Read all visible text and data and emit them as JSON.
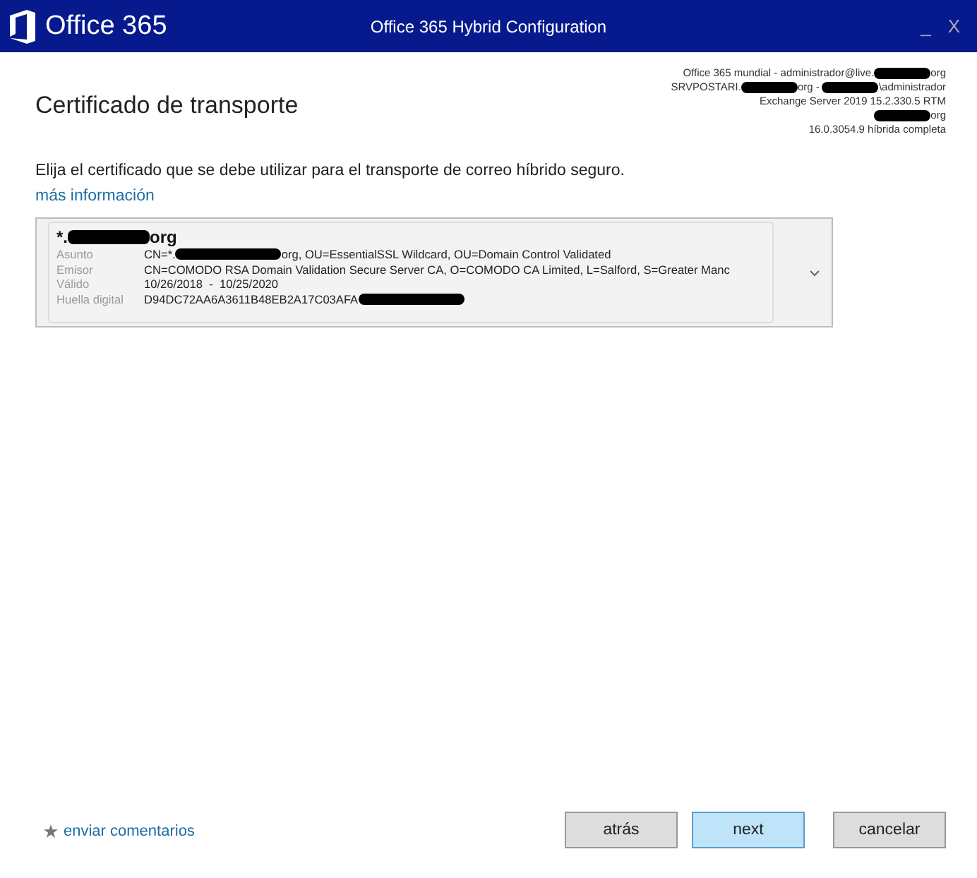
{
  "window": {
    "logo": "Office 365",
    "title": "Office 365 Hybrid Configuration",
    "controls": [
      "_",
      "X"
    ]
  },
  "connection_info": [
    [
      {
        "kind": "text",
        "text": "Office 365 mundial - administrador@live."
      },
      {
        "kind": "redacted"
      },
      {
        "kind": "text",
        "text": "org"
      }
    ],
    [
      {
        "kind": "text",
        "text": "SRVPOSTARI."
      },
      {
        "kind": "redacted"
      },
      {
        "kind": "text",
        "text": "org - "
      },
      {
        "kind": "redacted"
      },
      {
        "kind": "text",
        "text": "\\administrador"
      }
    ],
    [
      {
        "kind": "text",
        "text": "Exchange Server 2019 15.2.330.5 RTM"
      }
    ],
    [
      {
        "kind": "redacted"
      },
      {
        "kind": "text",
        "text": "org"
      }
    ],
    [
      {
        "kind": "text",
        "text": "16.0.3054.9 híbrida completa"
      }
    ]
  ],
  "heading": "Certificado de transporte",
  "instruction": "Elija el certificado que se debe utilizar para el transporte de correo híbrido seguro.",
  "more_info_link": "más información",
  "certificate": {
    "name": [
      {
        "kind": "text",
        "text": "*."
      },
      {
        "kind": "redacted"
      },
      {
        "kind": "text",
        "text": "org"
      }
    ],
    "fields": [
      {
        "label": "Asunto",
        "value": [
          {
            "kind": "text",
            "text": "CN=*."
          },
          {
            "kind": "redacted"
          },
          {
            "kind": "text",
            "text": "org, OU=EssentialSSL Wildcard, OU=Domain Control Validated"
          }
        ]
      },
      {
        "label": "Emisor",
        "value": [
          {
            "kind": "text",
            "text": "CN=COMODO RSA Domain Validation Secure Server CA, O=COMODO CA Limited, L=Salford, S=Greater Manc"
          }
        ]
      },
      {
        "label": "Válido",
        "value": [
          {
            "kind": "text",
            "text": "10/26/2018  -  10/25/2020"
          }
        ]
      },
      {
        "label": "Huella digital",
        "value": [
          {
            "kind": "text",
            "text": "D94DC72AA6A3611B48EB2A17C03AFA"
          },
          {
            "kind": "redacted"
          }
        ]
      }
    ]
  },
  "feedback_link": "enviar comentarios",
  "buttons": [
    {
      "label": "atrás",
      "selected": false
    },
    {
      "label": "next",
      "selected": true
    },
    {
      "label": "cancelar",
      "selected": false
    }
  ]
}
